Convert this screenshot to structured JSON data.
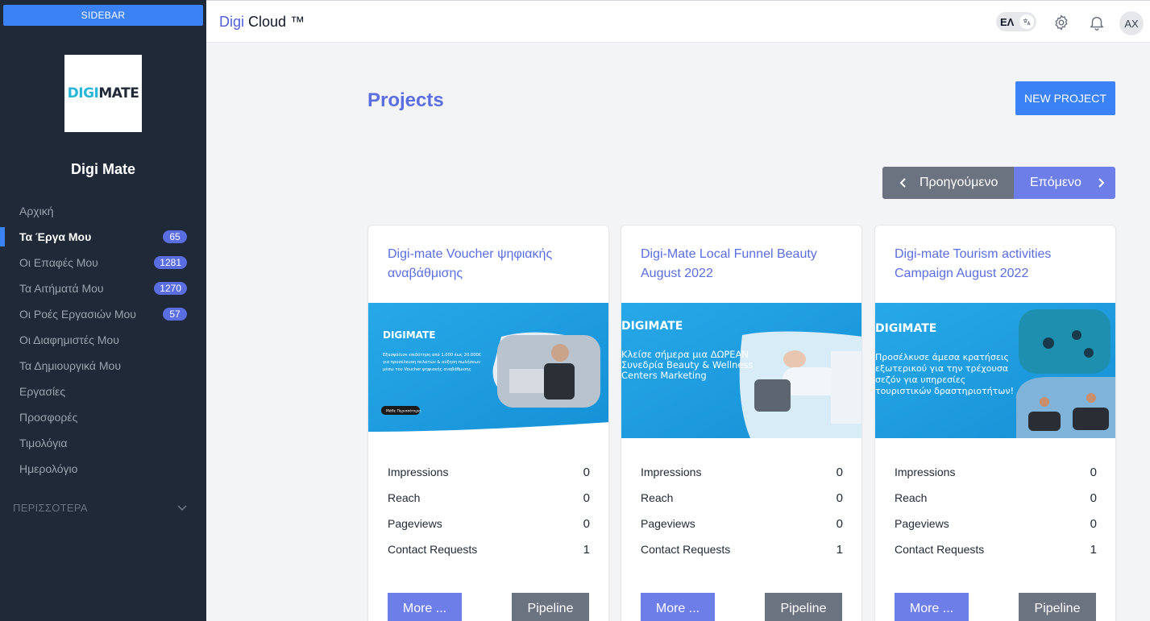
{
  "sidebar": {
    "toggle_label": "SIDEBAR",
    "logo_text_a": "DIGI",
    "logo_text_b": "MATE",
    "brand_name": "Digi Mate",
    "items": [
      {
        "label": "Αρχική",
        "badge": null,
        "active": false
      },
      {
        "label": "Τα Έργα Μου",
        "badge": "65",
        "active": true
      },
      {
        "label": "Οι Επαφές Μου",
        "badge": "1281",
        "active": false
      },
      {
        "label": "Τα Αιτήματά Μου",
        "badge": "1270",
        "active": false
      },
      {
        "label": "Οι Ροές Εργασιών Μου",
        "badge": "57",
        "active": false
      },
      {
        "label": "Οι Διαφημιστές Μου",
        "badge": null,
        "active": false
      },
      {
        "label": "Τα Δημιουργικά Μου",
        "badge": null,
        "active": false
      },
      {
        "label": "Εργασίες",
        "badge": null,
        "active": false
      },
      {
        "label": "Προσφορές",
        "badge": null,
        "active": false
      },
      {
        "label": "Τιμολόγια",
        "badge": null,
        "active": false
      },
      {
        "label": "Ημερολόγιο",
        "badge": null,
        "active": false
      }
    ],
    "more_label": "ΠΕΡΙΣΣΟΤΕΡΑ"
  },
  "topbar": {
    "title_a": "Digi",
    "title_b": " Cloud ™",
    "lang": "ΕΛ",
    "avatar_initials": "AX"
  },
  "main": {
    "page_title": "Projects",
    "new_project_label": "NEW PROJECT",
    "prev_label": "Προηγούμενο",
    "next_label": "Επόμενο"
  },
  "stat_labels": [
    "Impressions",
    "Reach",
    "Pageviews",
    "Contact Requests"
  ],
  "cards": [
    {
      "title": "Digi-mate Voucher ψηφιακής αναβάθμισης",
      "stats": [
        "0",
        "0",
        "0",
        "1"
      ],
      "more_label": "More ...",
      "pipeline_label": "Pipeline",
      "banner_logo": "DIGIMATE",
      "banner_lines": [
        "Εξασφάλισε επιδότηση από 1.000 έως 20.000€",
        "για προσέλκυση πελατών & αύξηση πωλήσεων",
        "μέσω του Voucher ψηφιακής αναβάθμισης"
      ],
      "banner_cta": "Μάθε Περισσότερα"
    },
    {
      "title": "Digi-Mate Local Funnel Beauty August 2022",
      "stats": [
        "0",
        "0",
        "0",
        "1"
      ],
      "more_label": "More ...",
      "pipeline_label": "Pipeline",
      "banner_logo": "DIGIMATE",
      "banner_lines": [
        "Κλείσε σήμερα μια ΔΩΡΕΑΝ",
        "Συνεδρία Beauty & Wellness",
        "Centers Marketing"
      ]
    },
    {
      "title": "Digi-mate Tourism activities Campaign August 2022",
      "stats": [
        "0",
        "0",
        "0",
        "1"
      ],
      "more_label": "More ...",
      "pipeline_label": "Pipeline",
      "banner_logo": "DIGIMATE",
      "banner_lines": [
        "Προσέλκυσε άμεσα κρατήσεις",
        "εξωτερικού για την τρέχουσα",
        "σεζόν για υπηρεσίες",
        "τουριστικών δραστηριοτήτων!"
      ]
    }
  ],
  "colors": {
    "sidebar_bg": "#1f2937",
    "accent": "#3b82f6",
    "primary": "#5b6ee1",
    "secondary": "#6b7280",
    "banner_blue": "#1da1e0"
  }
}
